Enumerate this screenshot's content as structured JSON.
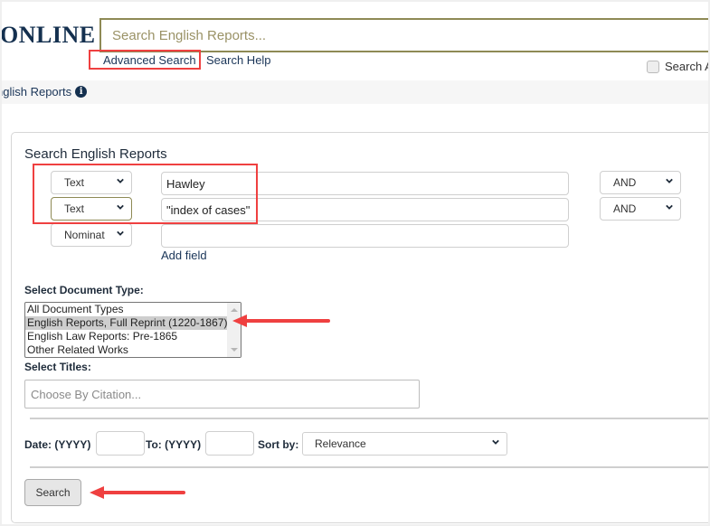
{
  "header": {
    "logo_text": "ONLINE",
    "search_placeholder": "Search English Reports...",
    "advanced_search_label": "Advanced Search",
    "search_help_label": "Search Help",
    "search_all_label": "Search A"
  },
  "breadcrumb": {
    "label": "nglish Reports",
    "info_icon": "info-circle-icon"
  },
  "form": {
    "title": "Search English Reports",
    "rows": [
      {
        "field_type": "Text",
        "value": "Hawley",
        "operator": "AND"
      },
      {
        "field_type": "Text",
        "value": "\"index of cases\"",
        "operator": "AND"
      },
      {
        "field_type": "Nominat",
        "value": "",
        "operator": null
      }
    ],
    "add_field_label": "Add field",
    "document_type_label": "Select Document Type:",
    "document_types": [
      {
        "label": "All Document Types",
        "selected": false
      },
      {
        "label": "English Reports, Full Reprint (1220-1867)",
        "selected": true
      },
      {
        "label": "English Law Reports: Pre-1865",
        "selected": false
      },
      {
        "label": "Other Related Works",
        "selected": false
      }
    ],
    "titles_label": "Select Titles:",
    "titles_placeholder": "Choose By Citation...",
    "date_from_label": "Date: (YYYY)",
    "date_from_value": "",
    "date_to_label": "To: (YYYY)",
    "date_to_value": "",
    "sort_label": "Sort by:",
    "sort_value": "Relevance",
    "search_button_label": "Search"
  },
  "annotations": {
    "highlight_color": "#ef4040"
  }
}
